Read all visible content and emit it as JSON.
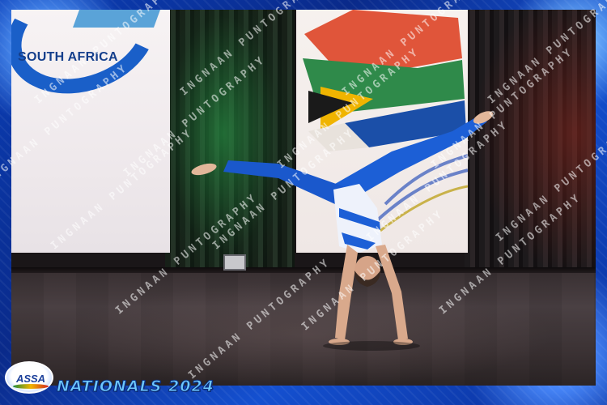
{
  "banner": {
    "left_text": "SOUTH AFRICA"
  },
  "footer": {
    "logo_text": "ASSA",
    "event_title": "NATIONALS 2024"
  },
  "watermark": {
    "text": "INGNAAN PUNTOGRAPHY"
  },
  "colors": {
    "frame_blue": "#0a2a8a",
    "costume_blue": "#1c5fd6",
    "banner_navy": "#153f8c"
  }
}
